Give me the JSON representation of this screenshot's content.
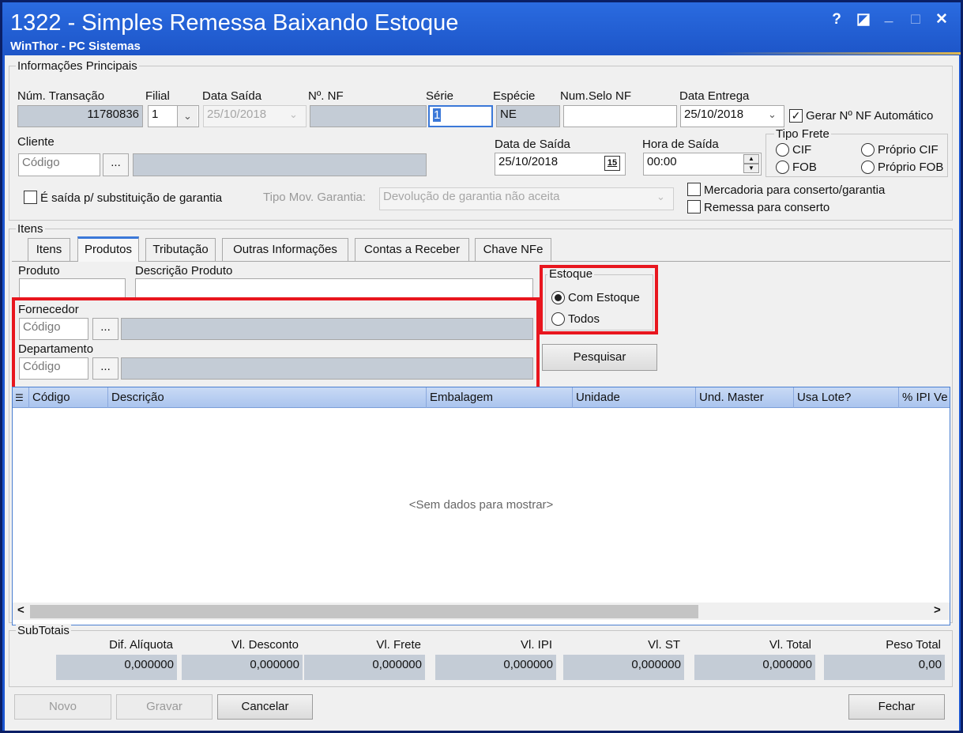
{
  "window": {
    "title": "1322 - Simples Remessa Baixando Estoque",
    "subtitle": "WinThor - PC Sistemas",
    "controls": {
      "help": "?",
      "restore": "◪",
      "minimize": "_",
      "maximize": "□",
      "close": "✕"
    }
  },
  "principal": {
    "group_title": "Informações Principais",
    "num_transacao": {
      "label": "Núm. Transação",
      "value": "11780836"
    },
    "filial": {
      "label": "Filial",
      "value": "1"
    },
    "data_saida": {
      "label": "Data Saída",
      "value": "25/10/2018"
    },
    "num_nf": {
      "label": "Nº. NF",
      "value": ""
    },
    "serie": {
      "label": "Série",
      "value": "1"
    },
    "especie": {
      "label": "Espécie",
      "value": "NE"
    },
    "num_selo": {
      "label": "Num.Selo NF",
      "value": ""
    },
    "data_entrega": {
      "label": "Data Entrega",
      "value": "25/10/2018"
    },
    "gerar_nf": {
      "label": "Gerar Nº NF Automático",
      "checked": true
    },
    "cliente": {
      "label": "Cliente",
      "placeholder": "Código",
      "ellipsis": "...",
      "name": ""
    },
    "data_de_saida": {
      "label": "Data de Saída",
      "value": "25/10/2018",
      "cal_icon": "15"
    },
    "hora_saida": {
      "label": "Hora de Saída",
      "value": "00:00"
    },
    "tipo_frete": {
      "title": "Tipo Frete",
      "cif": "CIF",
      "fob": "FOB",
      "proprio_cif": "Próprio CIF",
      "proprio_fob": "Próprio FOB"
    },
    "saida_garantia": {
      "label": "É saída p/ substituição de garantia",
      "checked": false
    },
    "tipo_mov": {
      "label": "Tipo Mov. Garantia:",
      "value": "Devolução de garantia não aceita"
    },
    "mercadoria": {
      "label": "Mercadoria para conserto/garantia",
      "checked": false
    },
    "remessa": {
      "label": "Remessa para conserto",
      "checked": false
    }
  },
  "itens": {
    "group_title": "Itens",
    "tabs": [
      "Itens",
      "Produtos",
      "Tributação",
      "Outras Informações",
      "Contas a Receber",
      "Chave NFe"
    ],
    "produto_label": "Produto",
    "descricao_label": "Descrição Produto",
    "fornecedor": {
      "label": "Fornecedor",
      "placeholder": "Código",
      "ellipsis": "..."
    },
    "departamento": {
      "label": "Departamento",
      "placeholder": "Código",
      "ellipsis": "..."
    },
    "estoque": {
      "title": "Estoque",
      "com": "Com Estoque",
      "todos": "Todos",
      "selected": "Com Estoque"
    },
    "pesquisar": "Pesquisar"
  },
  "grid": {
    "columns": [
      "Código",
      "Descrição",
      "Embalagem",
      "Unidade",
      "Und. Master",
      "Usa Lote?",
      "% IPI Ve"
    ],
    "empty_text": "<Sem dados para mostrar>",
    "scroll_left": "<",
    "scroll_right": ">"
  },
  "subtotais": {
    "title": "SubTotais",
    "labels": [
      "Dif. Alíquota",
      "Vl. Desconto",
      "Vl. Frete",
      "Vl. IPI",
      "Vl. ST",
      "Vl. Total",
      "Peso Total"
    ],
    "values": [
      "0,000000",
      "0,000000",
      "0,000000",
      "0,000000",
      "0,000000",
      "0,000000",
      "0,00"
    ]
  },
  "footer": {
    "novo": "Novo",
    "gravar": "Gravar",
    "cancelar": "Cancelar",
    "fechar": "Fechar"
  }
}
